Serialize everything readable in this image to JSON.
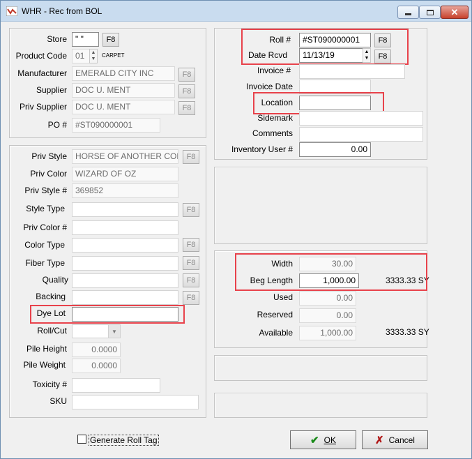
{
  "window": {
    "title": "WHR - Rec from BOL"
  },
  "header": {
    "store_label": "Store",
    "store_value": "\" \"",
    "product_code_label": "Product Code",
    "product_code_value": "01",
    "product_code_desc": "CARPET",
    "manufacturer_label": "Manufacturer",
    "manufacturer_value": "EMERALD CITY INC",
    "supplier_label": "Supplier",
    "supplier_value": "DOC U. MENT",
    "priv_supplier_label": "Priv Supplier",
    "priv_supplier_value": "DOC U. MENT",
    "po_label": "PO #",
    "po_value": "#ST090000001"
  },
  "style": {
    "priv_style_label": "Priv Style",
    "priv_style_value": "HORSE OF ANOTHER COLOR",
    "priv_color_label": "Priv Color",
    "priv_color_value": "WIZARD OF OZ",
    "priv_style_num_label": "Priv Style #",
    "priv_style_num_value": "369852",
    "style_type_label": "Style Type",
    "style_type_value": "",
    "priv_color_num_label": "Priv Color #",
    "priv_color_num_value": "",
    "color_type_label": "Color Type",
    "color_type_value": "",
    "fiber_type_label": "Fiber Type",
    "fiber_type_value": "",
    "quality_label": "Quality",
    "quality_value": "",
    "backing_label": "Backing",
    "backing_value": "",
    "dye_lot_label": "Dye Lot",
    "dye_lot_value": "",
    "roll_cut_label": "Roll/Cut",
    "roll_cut_value": "",
    "pile_height_label": "Pile Height",
    "pile_height_value": "0.0000",
    "pile_weight_label": "Pile Weight",
    "pile_weight_value": "0.0000",
    "toxicity_label": "Toxicity #",
    "toxicity_value": "",
    "sku_label": "SKU",
    "sku_value": ""
  },
  "roll": {
    "roll_label": "Roll #",
    "roll_value": "#ST090000001",
    "date_rcvd_label": "Date Rcvd",
    "date_rcvd_value": "11/13/19",
    "invoice_label": "Invoice #",
    "invoice_value": "",
    "invoice_date_label": "Invoice Date",
    "invoice_date_value": "",
    "location_label": "Location",
    "location_value": "",
    "sidemark_label": "Sidemark",
    "sidemark_value": "",
    "comments_label": "Comments",
    "comments_value": "",
    "inventory_user_label": "Inventory User #",
    "inventory_user_value": "0.00"
  },
  "quantities": {
    "width_label": "Width",
    "width_value": "30.00",
    "beg_length_label": "Beg Length",
    "beg_length_value": "1,000.00",
    "beg_length_sy": "3333.33 SY",
    "used_label": "Used",
    "used_value": "0.00",
    "reserved_label": "Reserved",
    "reserved_value": "0.00",
    "available_label": "Available",
    "available_value": "1,000.00",
    "available_sy": "3333.33 SY"
  },
  "footer": {
    "generate_roll_tag_label": "Generate Roll Tag",
    "generate_roll_tag_checked": false,
    "ok_label": "OK",
    "cancel_label": "Cancel"
  },
  "f8_label": "F8",
  "colors": {
    "highlight": "#e8424b",
    "titlebar": "#c9dcef",
    "ok_check": "#1a8a1a",
    "cancel_x": "#b01515"
  }
}
